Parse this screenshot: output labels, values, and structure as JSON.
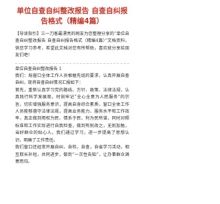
{
  "document": {
    "title": "单位自查自纠整改报告 自查自纠报告格式（精编4篇）",
    "guide_label": "【导读指引】",
    "guide_text": "三一刀客最漂亮的网友为您整理分享的“单位自查自纠整改报告 自查自纠报告格式（精编4篇）”文档资料，供您学习参考，希望此文档对您有所帮助，喜欢就分享给朋友们吧！",
    "section_title": "单位自查自纠整改报告 1",
    "paragraphs": [
      "我们：局窗口全体工作人员根据先组的要求，认真开展自查自纠，现将自查自纠情况汇报如下：",
      "首先，重新认真学习党的路线、方针、政策、法律法规，认真践行科学发展观，时刻牢记“全心全意为人民服务”的宗旨，切实增强服务意识，提高自身综合素质，窗口全体工作人员能够遵守法律法规，提高业务能力、服务水平和工作效率，真正做到用权为民、情系于民、利为民所谋，同时对照标准和工作实际进行自我检查，做到有则改之，无则加勉，当好群众的贴心人。我们通过学习，进一步提高了思想认识，明确了工作责任。",
      "我们窗口还经常开展自纠，自检，自查，自省学习活动，相互取长补短，共同进步，做到“一次性告知”，让办事群众满意而归。"
    ]
  }
}
